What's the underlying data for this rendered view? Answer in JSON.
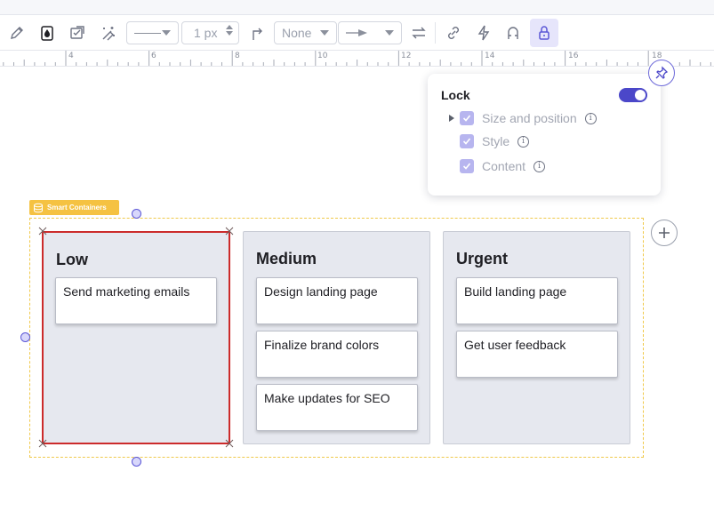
{
  "toolbar": {
    "line_width": "1 px",
    "arrow_start": "None",
    "icons": [
      "pencil-icon",
      "fill-drop-icon",
      "style-checklist-icon",
      "magic-wand-icon",
      "line-style-select",
      "line-width-stepper",
      "elbow-connector-icon",
      "arrow-start-select",
      "arrow-end-select",
      "swap-arrows-icon",
      "link-icon",
      "lightning-icon",
      "magnet-icon",
      "lock-icon"
    ],
    "accent_color": "#5a56d6"
  },
  "ruler": {
    "labels": [
      "4",
      "6",
      "8",
      "10",
      "12",
      "14",
      "16",
      "18"
    ]
  },
  "smart_container": {
    "label": "Smart Containers",
    "label_color": "#f5c242",
    "columns": [
      {
        "title": "Low",
        "cards": [
          "Send marketing emails"
        ]
      },
      {
        "title": "Medium",
        "cards": [
          "Design landing page",
          "Finalize brand colors",
          "Make updates for SEO"
        ]
      },
      {
        "title": "Urgent",
        "cards": [
          "Build landing page",
          "Get user feedback"
        ]
      }
    ],
    "selection_color": "#cc2b2b"
  },
  "lock_popover": {
    "title": "Lock",
    "enabled": true,
    "options": [
      {
        "label": "Size and position",
        "checked": true
      },
      {
        "label": "Style",
        "checked": true
      },
      {
        "label": "Content",
        "checked": true
      }
    ]
  }
}
